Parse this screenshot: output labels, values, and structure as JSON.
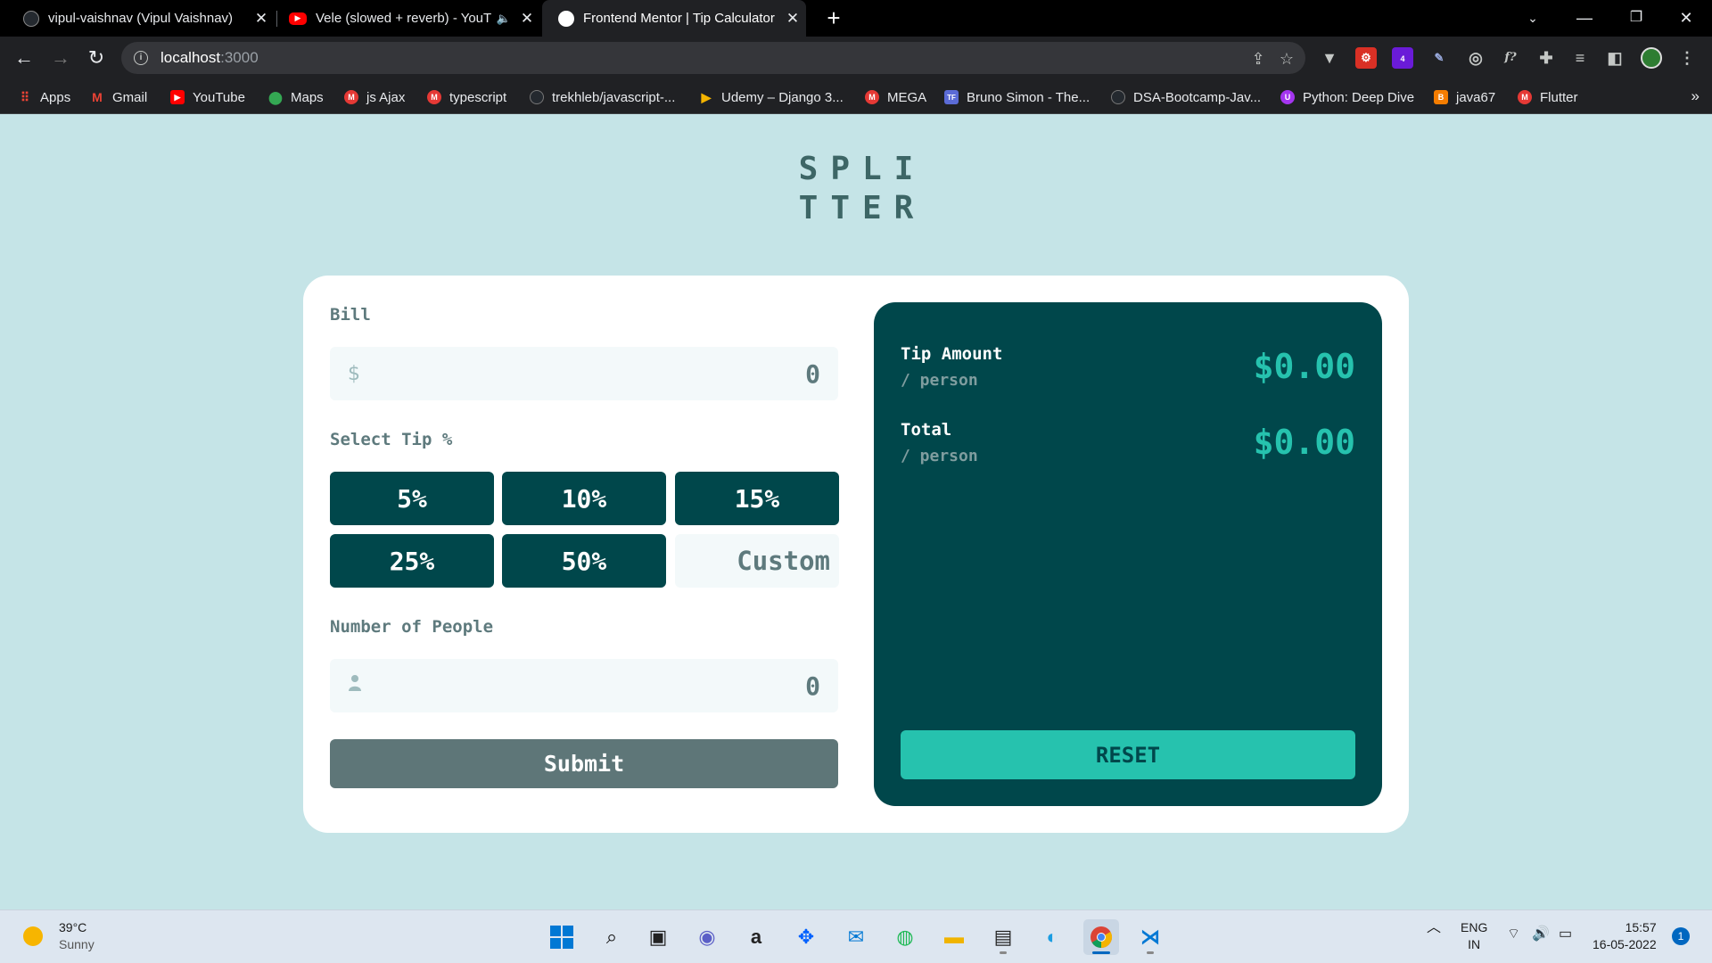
{
  "browser": {
    "tabs": [
      {
        "title": "vipul-vaishnav (Vipul Vaishnav)",
        "icon": "github-icon"
      },
      {
        "title": "Vele (slowed + reverb) - YouT",
        "icon": "youtube-icon"
      },
      {
        "title": "Frontend Mentor | Tip Calculator",
        "icon": "frontendmentor-icon"
      }
    ],
    "url_host": "localhost",
    "url_port": ":3000",
    "extension_badge": "4",
    "bookmarks": [
      "Apps",
      "Gmail",
      "YouTube",
      "Maps",
      "js Ajax",
      "typescript",
      "trekhleb/javascript-...",
      "Udemy – Django 3...",
      "MEGA",
      "Bruno Simon - The...",
      "DSA-Bootcamp-Jav...",
      "Python: Deep Dive",
      "java67",
      "Flutter"
    ],
    "bookmark_glyphs": {
      "tf": "TF"
    }
  },
  "app": {
    "logo_line1": "SPLI",
    "logo_line2": "TTER",
    "bill_label": "Bill",
    "bill_prefix": "$",
    "bill_value": "0",
    "tip_label": "Select Tip %",
    "tips": [
      "5%",
      "10%",
      "15%",
      "25%",
      "50%"
    ],
    "custom_placeholder": "Custom",
    "people_label": "Number of People",
    "people_value": "0",
    "submit_label": "Submit",
    "tip_amount_label": "Tip Amount",
    "tip_amount_sub": "/ person",
    "tip_amount_value": "$0.00",
    "total_label": "Total",
    "total_sub": "/ person",
    "total_value": "$0.00",
    "reset_label": "RESET"
  },
  "colors": {
    "background": "#c5e4e7",
    "dark_cyan": "#00474b",
    "strong_cyan": "#26c2ae",
    "submit_gray": "#5e7678"
  },
  "taskbar": {
    "temperature": "39°C",
    "weather": "Sunny",
    "language": "ENG",
    "region": "IN",
    "time": "15:57",
    "date": "16-05-2022",
    "notifications": "1"
  }
}
